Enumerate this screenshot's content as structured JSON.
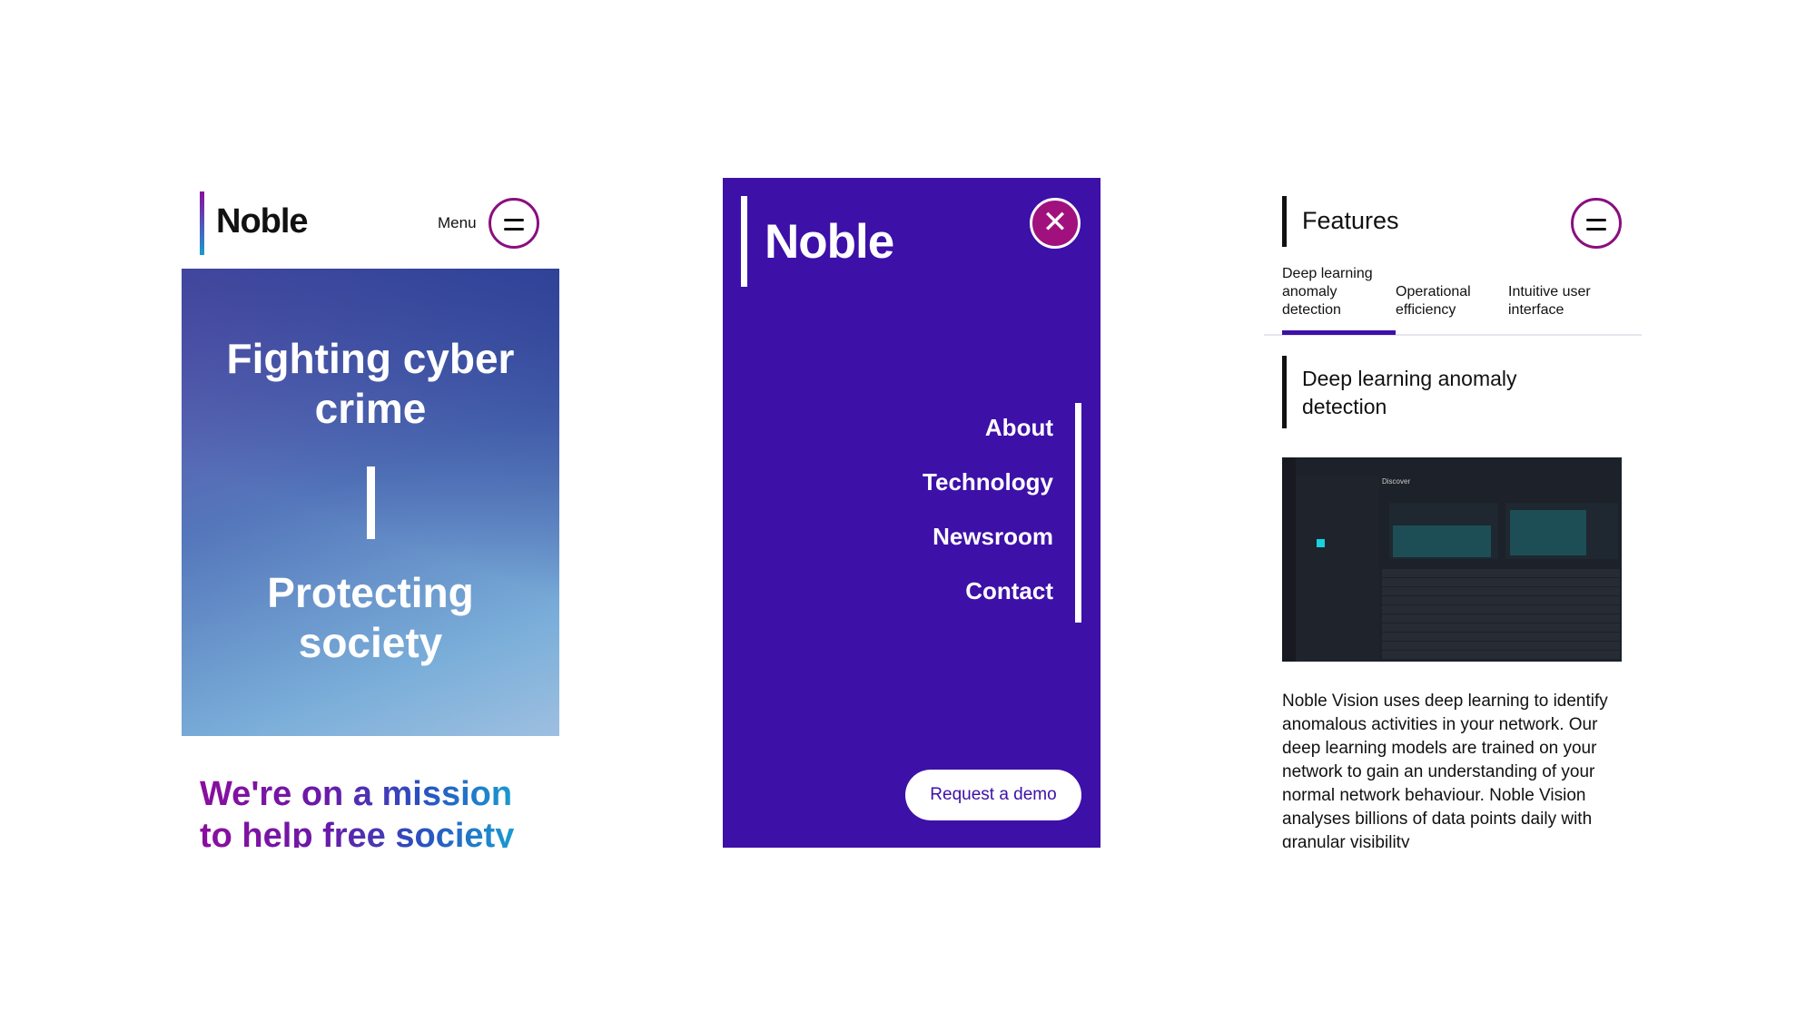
{
  "home": {
    "logo": "Noble",
    "menu_label": "Menu",
    "hero_line1": "Fighting cyber",
    "hero_line2": "crime",
    "hero_line3": "Protecting",
    "hero_line4": "society",
    "mission_line1": "We're on a mission",
    "mission_line2": "to help free society"
  },
  "menu": {
    "logo": "Noble",
    "items": [
      {
        "label": "About"
      },
      {
        "label": "Technology"
      },
      {
        "label": "Newsroom"
      },
      {
        "label": "Contact"
      }
    ],
    "cta": "Request a demo"
  },
  "features": {
    "title": "Features",
    "tabs": [
      {
        "label": "Deep learning anomaly detection",
        "active": true
      },
      {
        "label": "Operational efficiency"
      },
      {
        "label": "Intuitive user interface"
      }
    ],
    "heading": "Deep learning anomaly detection",
    "screenshot": {
      "title": "Discover"
    },
    "body": "Noble Vision uses deep learning to identify anomalous activities in your network. Our deep learning models are trained on your network to gain an understanding of your normal network behaviour. Noble Vision analyses billions of data points daily with granular visibility"
  },
  "colors": {
    "brand_purple": "#3d10a8",
    "accent_magenta": "#8a0e7e"
  }
}
